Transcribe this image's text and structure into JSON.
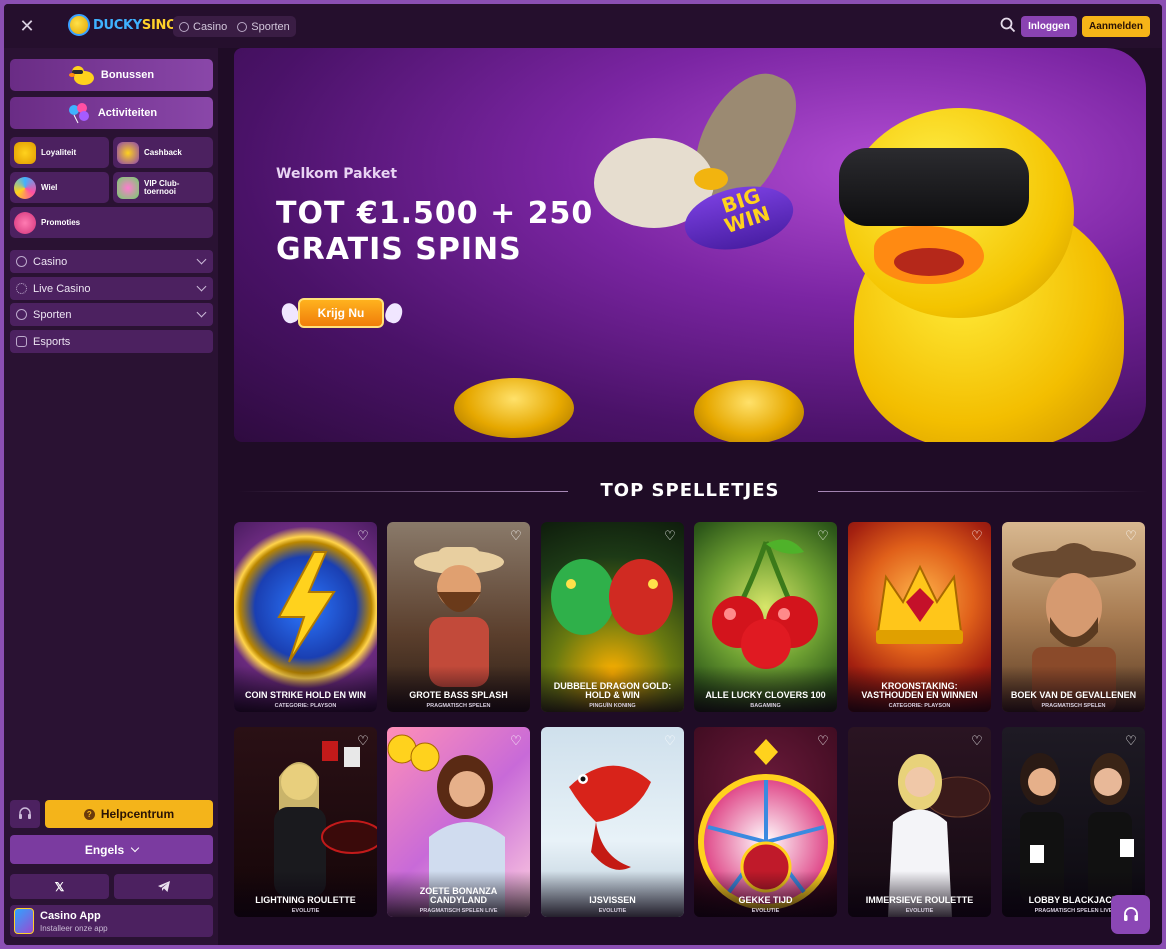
{
  "header": {
    "logo_text_a": "DUCKY",
    "logo_text_b": "SINO",
    "tabs": [
      {
        "label": "Casino"
      },
      {
        "label": "Sporten"
      }
    ],
    "login_label": "Inloggen",
    "signup_label": "Aanmelden"
  },
  "sidebar": {
    "bonuses_label": "Bonussen",
    "activities_label": "Activiteiten",
    "tiles": [
      {
        "label": "Loyaliteit"
      },
      {
        "label": "Cashback"
      },
      {
        "label": "Wiel"
      },
      {
        "label": "VIP Club-toernooi"
      },
      {
        "label": "Promoties"
      }
    ],
    "menu": [
      {
        "label": "Casino"
      },
      {
        "label": "Live Casino"
      },
      {
        "label": "Sporten"
      },
      {
        "label": "Esports"
      }
    ],
    "help_label": "Helpcentrum",
    "language_label": "Engels",
    "app_title": "Casino App",
    "app_subtitle": "Installeer onze app"
  },
  "hero": {
    "welcome": "Welkom Pakket",
    "title_line1": "TOT €1.500 + 250",
    "title_line2": "GRATIS SPINS",
    "cta_label": "Krijg Nu",
    "fish_text_line1": "BIG",
    "fish_text_line2": "WIN"
  },
  "section_title": "TOP SPELLETJES",
  "games": [
    {
      "title": "COIN STRIKE HOLD EN WIN",
      "provider": "CATEGORIE: PLAYSON"
    },
    {
      "title": "GROTE BASS SPLASH",
      "provider": "PRAGMATISCH SPELEN"
    },
    {
      "title": "DUBBELE DRAGON GOLD: HOLD & WIN",
      "provider": "PINGUÏN KONING"
    },
    {
      "title": "ALLE LUCKY CLOVERS 100",
      "provider": "BAGAMING"
    },
    {
      "title": "KROONSTAKING: VASTHOUDEN EN WINNEN",
      "provider": "CATEGORIE: PLAYSON"
    },
    {
      "title": "BOEK VAN DE GEVALLENEN",
      "provider": "PRAGMATISCH SPELEN"
    },
    {
      "title": "LIGHTNING ROULETTE",
      "provider": "EVOLUTIE"
    },
    {
      "title": "ZOETE BONANZA CANDYLAND",
      "provider": "PRAGMATISCH SPELEN LIVE"
    },
    {
      "title": "IJSVISSEN",
      "provider": "EVOLUTIE"
    },
    {
      "title": "GEKKE TIJD",
      "provider": "EVOLUTIE"
    },
    {
      "title": "IMMERSIEVE ROULETTE",
      "provider": "EVOLUTIE"
    },
    {
      "title": "LOBBY BLACKJACK",
      "provider": "PRAGMATISCH SPELEN LIVE"
    }
  ],
  "colors": {
    "accent_purple": "#8a43b2",
    "accent_yellow": "#f6b418",
    "background": "#1f0c26"
  }
}
